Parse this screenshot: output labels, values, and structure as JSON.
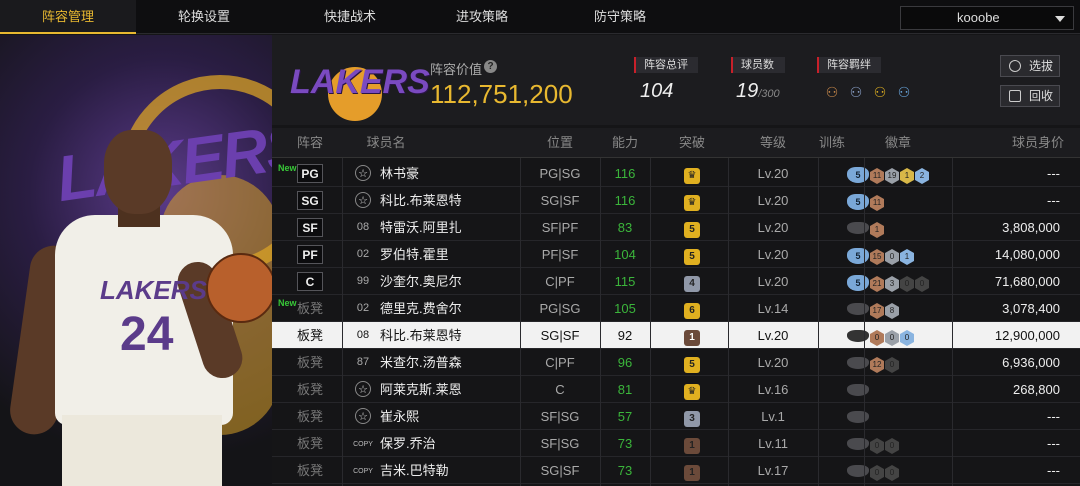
{
  "nav": {
    "tabs": [
      "阵容管理",
      "轮换设置",
      "快捷战术",
      "进攻策略",
      "防守策略"
    ],
    "active": 0,
    "account": "kooobe"
  },
  "summary": {
    "team_logo_text": "LAKERS",
    "value_label": "阵容价值",
    "value": "112,751,200",
    "rating_label": "阵容总评",
    "rating": "104",
    "players_label": "球员数",
    "players": "19",
    "players_max": "/300",
    "bonds_label": "阵容羁绊",
    "select_btn": "选拔",
    "recycle_btn": "回收"
  },
  "table": {
    "headers": [
      "阵容",
      "球员名",
      "位置",
      "能力",
      "突破",
      "等级",
      "训练",
      "徽章",
      "球员身价"
    ],
    "rows": [
      {
        "pos": "PG",
        "type": "starter",
        "new": "New",
        "jersey": "☆",
        "name": "林书豪",
        "positions": "PG|SG",
        "ability": "116",
        "breakthrough": "♛",
        "bk_color": "#e0b020",
        "level": "Lv.20",
        "training": "5",
        "badges": [
          [
            "11",
            "b"
          ],
          [
            "19",
            "s"
          ],
          [
            "1",
            "g"
          ],
          [
            "2",
            "d"
          ]
        ],
        "value": "---"
      },
      {
        "pos": "SG",
        "type": "starter",
        "new": "",
        "jersey": "☆",
        "name": "科比.布莱恩特",
        "positions": "SG|SF",
        "ability": "116",
        "breakthrough": "♛",
        "bk_color": "#e0b020",
        "level": "Lv.20",
        "training": "5",
        "badges": [
          [
            "11",
            "b"
          ]
        ],
        "value": "---"
      },
      {
        "pos": "SF",
        "type": "starter",
        "new": "",
        "jersey": "08",
        "name": "特雷沃.阿里扎",
        "positions": "SF|PF",
        "ability": "83",
        "breakthrough": "5",
        "bk_color": "#e0b020",
        "level": "Lv.20",
        "training": "",
        "badges": [
          [
            "1",
            "b"
          ]
        ],
        "value": "3,808,000"
      },
      {
        "pos": "PF",
        "type": "starter",
        "new": "",
        "jersey": "02",
        "name": "罗伯特.霍里",
        "positions": "PF|SF",
        "ability": "104",
        "breakthrough": "5",
        "bk_color": "#e0b020",
        "level": "Lv.20",
        "training": "5",
        "badges": [
          [
            "15",
            "b"
          ],
          [
            "0",
            "s"
          ],
          [
            "1",
            "d"
          ]
        ],
        "value": "14,080,000"
      },
      {
        "pos": "C",
        "type": "starter",
        "new": "",
        "jersey": "99",
        "name": "沙奎尔.奥尼尔",
        "positions": "C|PF",
        "ability": "115",
        "breakthrough": "4",
        "bk_color": "#9098a8",
        "level": "Lv.20",
        "training": "5",
        "badges": [
          [
            "21",
            "b"
          ],
          [
            "3",
            "s"
          ],
          [
            "0",
            "e"
          ],
          [
            "0",
            "e"
          ]
        ],
        "value": "71,680,000"
      },
      {
        "pos": "板凳",
        "type": "bench",
        "new": "New",
        "jersey": "02",
        "name": "德里克.费舍尔",
        "positions": "PG|SG",
        "ability": "105",
        "breakthrough": "6",
        "bk_color": "#e0b020",
        "level": "Lv.14",
        "training": "",
        "badges": [
          [
            "17",
            "b"
          ],
          [
            "8",
            "s"
          ]
        ],
        "value": "3,078,400"
      },
      {
        "pos": "板凳",
        "type": "selected",
        "new": "",
        "jersey": "08",
        "name": "科比.布莱恩特",
        "positions": "SG|SF",
        "ability": "92",
        "breakthrough": "1",
        "bk_color": "#6b4a3a",
        "level": "Lv.20",
        "training": "",
        "badges": [
          [
            "0",
            "b"
          ],
          [
            "0",
            "s"
          ],
          [
            "0",
            "d"
          ]
        ],
        "value": "12,900,000"
      },
      {
        "pos": "板凳",
        "type": "bench",
        "new": "",
        "jersey": "87",
        "name": "米查尔.汤普森",
        "positions": "C|PF",
        "ability": "96",
        "breakthrough": "5",
        "bk_color": "#e0b020",
        "level": "Lv.20",
        "training": "",
        "badges": [
          [
            "12",
            "b"
          ],
          [
            "0",
            "e"
          ]
        ],
        "value": "6,936,000"
      },
      {
        "pos": "板凳",
        "type": "bench",
        "new": "",
        "jersey": "☆",
        "name": "阿莱克斯.莱恩",
        "positions": "C",
        "ability": "81",
        "breakthrough": "♛",
        "bk_color": "#e0b020",
        "level": "Lv.16",
        "training": "",
        "badges": [],
        "value": "268,800"
      },
      {
        "pos": "板凳",
        "type": "bench",
        "new": "",
        "jersey": "☆",
        "name": "崔永熙",
        "positions": "SF|SG",
        "ability": "57",
        "breakthrough": "3",
        "bk_color": "#9098a8",
        "level": "Lv.1",
        "training": "",
        "badges": [],
        "value": "---"
      },
      {
        "pos": "板凳",
        "type": "bench",
        "new": "",
        "jersey": "COPY",
        "name": "保罗.乔治",
        "positions": "SF|SG",
        "ability": "73",
        "breakthrough": "1",
        "bk_color": "#6b4a3a",
        "level": "Lv.11",
        "training": "",
        "badges": [
          [
            "0",
            "e"
          ],
          [
            "0",
            "e"
          ]
        ],
        "value": "---"
      },
      {
        "pos": "板凳",
        "type": "bench",
        "new": "",
        "jersey": "COPY",
        "name": "吉米.巴特勒",
        "positions": "SG|SF",
        "ability": "73",
        "breakthrough": "1",
        "bk_color": "#6b4a3a",
        "level": "Lv.17",
        "training": "",
        "badges": [
          [
            "0",
            "e"
          ],
          [
            "0",
            "e"
          ]
        ],
        "value": "---"
      }
    ]
  }
}
